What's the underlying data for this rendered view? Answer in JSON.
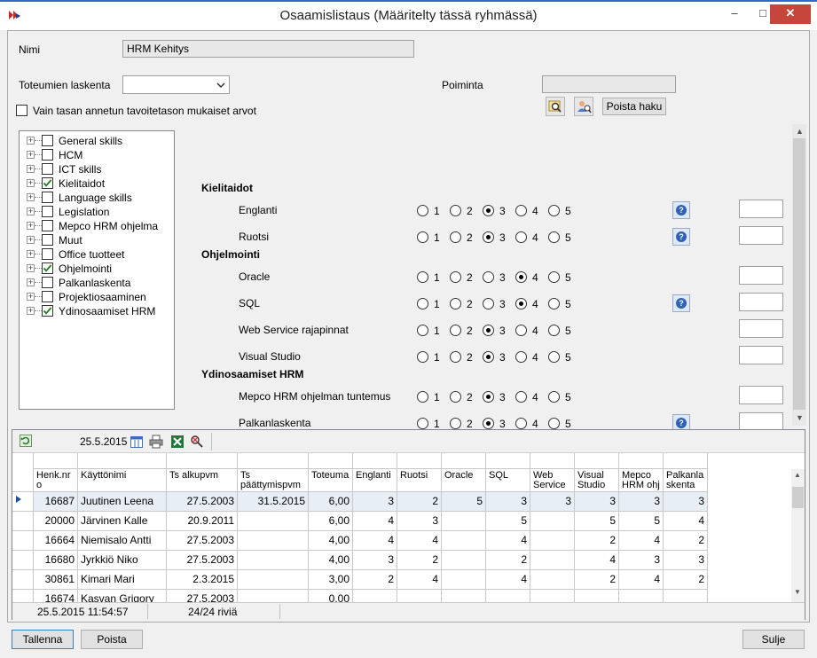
{
  "window": {
    "title": "Osaamislistaus (Määritelty tässä ryhmässä)",
    "minimize": "–",
    "maximize": "□",
    "close": "✕"
  },
  "form": {
    "name_label": "Nimi",
    "name_value": "HRM Kehitys",
    "calc_label": "Toteumien laskenta",
    "calc_value": "",
    "filter_label": "Poiminta",
    "filter_value": "",
    "only_level_label": "Vain tasan annetun tavoitetason mukaiset arvot",
    "clear_search": "Poista haku"
  },
  "tree": [
    {
      "label": "General skills",
      "checked": false
    },
    {
      "label": "HCM",
      "checked": false
    },
    {
      "label": "ICT skills",
      "checked": false
    },
    {
      "label": "Kielitaidot",
      "checked": true
    },
    {
      "label": "Language skills",
      "checked": false
    },
    {
      "label": "Legislation",
      "checked": false
    },
    {
      "label": "Mepco HRM ohjelma",
      "checked": false
    },
    {
      "label": "Muut",
      "checked": false
    },
    {
      "label": "Office tuotteet",
      "checked": false
    },
    {
      "label": "Ohjelmointi",
      "checked": true
    },
    {
      "label": "Palkanlaskenta",
      "checked": false
    },
    {
      "label": "Projektiosaaminen",
      "checked": false
    },
    {
      "label": "Ydinosaamiset HRM",
      "checked": true
    }
  ],
  "skill_groups": [
    {
      "title": "Kielitaidot",
      "skills": [
        {
          "name": "Englanti",
          "level": 3,
          "help": true
        },
        {
          "name": "Ruotsi",
          "level": 3,
          "help": true
        }
      ]
    },
    {
      "title": "Ohjelmointi",
      "skills": [
        {
          "name": "Oracle",
          "level": 4,
          "help": false
        },
        {
          "name": "SQL",
          "level": 4,
          "help": true
        },
        {
          "name": "Web Service rajapinnat",
          "level": 3,
          "help": false
        },
        {
          "name": "Visual Studio",
          "level": 3,
          "help": false
        }
      ]
    },
    {
      "title": "Ydinosaamiset HRM",
      "skills": [
        {
          "name": "Mepco HRM ohjelman tuntemus",
          "level": 3,
          "help": false
        },
        {
          "name": "Palkanlaskenta",
          "level": 3,
          "help": true
        }
      ]
    }
  ],
  "radio_labels": [
    "1",
    "2",
    "3",
    "4",
    "5"
  ],
  "grid": {
    "date": "25.5.2015",
    "columns": [
      "Henk.nr o",
      "Käyttönimi",
      "Ts alkupvm",
      "Ts päättymispvm",
      "Toteuma",
      "Englanti",
      "Ruotsi",
      "Oracle",
      "SQL",
      "Web Service r",
      "Visual Studio",
      "Mepco HRM ohj",
      "Palkanla skenta"
    ],
    "rows": [
      [
        "16687",
        "Juutinen Leena",
        "27.5.2003",
        "31.5.2015",
        "6,00",
        "3",
        "2",
        "5",
        "3",
        "3",
        "3",
        "3",
        "3"
      ],
      [
        "20000",
        "Järvinen Kalle",
        "20.9.2011",
        "",
        "6,00",
        "4",
        "3",
        "",
        "5",
        "",
        "5",
        "5",
        "4"
      ],
      [
        "16664",
        "Niemisalo Antti",
        "27.5.2003",
        "",
        "4,00",
        "4",
        "4",
        "",
        "4",
        "",
        "2",
        "4",
        "2"
      ],
      [
        "16680",
        "Jyrkkiö Niko",
        "27.5.2003",
        "",
        "4,00",
        "3",
        "2",
        "",
        "2",
        "",
        "4",
        "3",
        "3"
      ],
      [
        "30861",
        "Kimari Mari",
        "2.3.2015",
        "",
        "3,00",
        "2",
        "4",
        "",
        "4",
        "",
        "2",
        "4",
        "2"
      ],
      [
        "16674",
        "Kasvan Grigory",
        "27.5.2003",
        "",
        "0,00",
        "",
        "",
        "",
        "",
        "",
        "",
        "",
        ""
      ]
    ],
    "status_time": "25.5.2015 11:54:57",
    "status_rows": "24/24 riviä"
  },
  "buttons": {
    "save": "Tallenna",
    "delete": "Poista",
    "close": "Sulje"
  }
}
